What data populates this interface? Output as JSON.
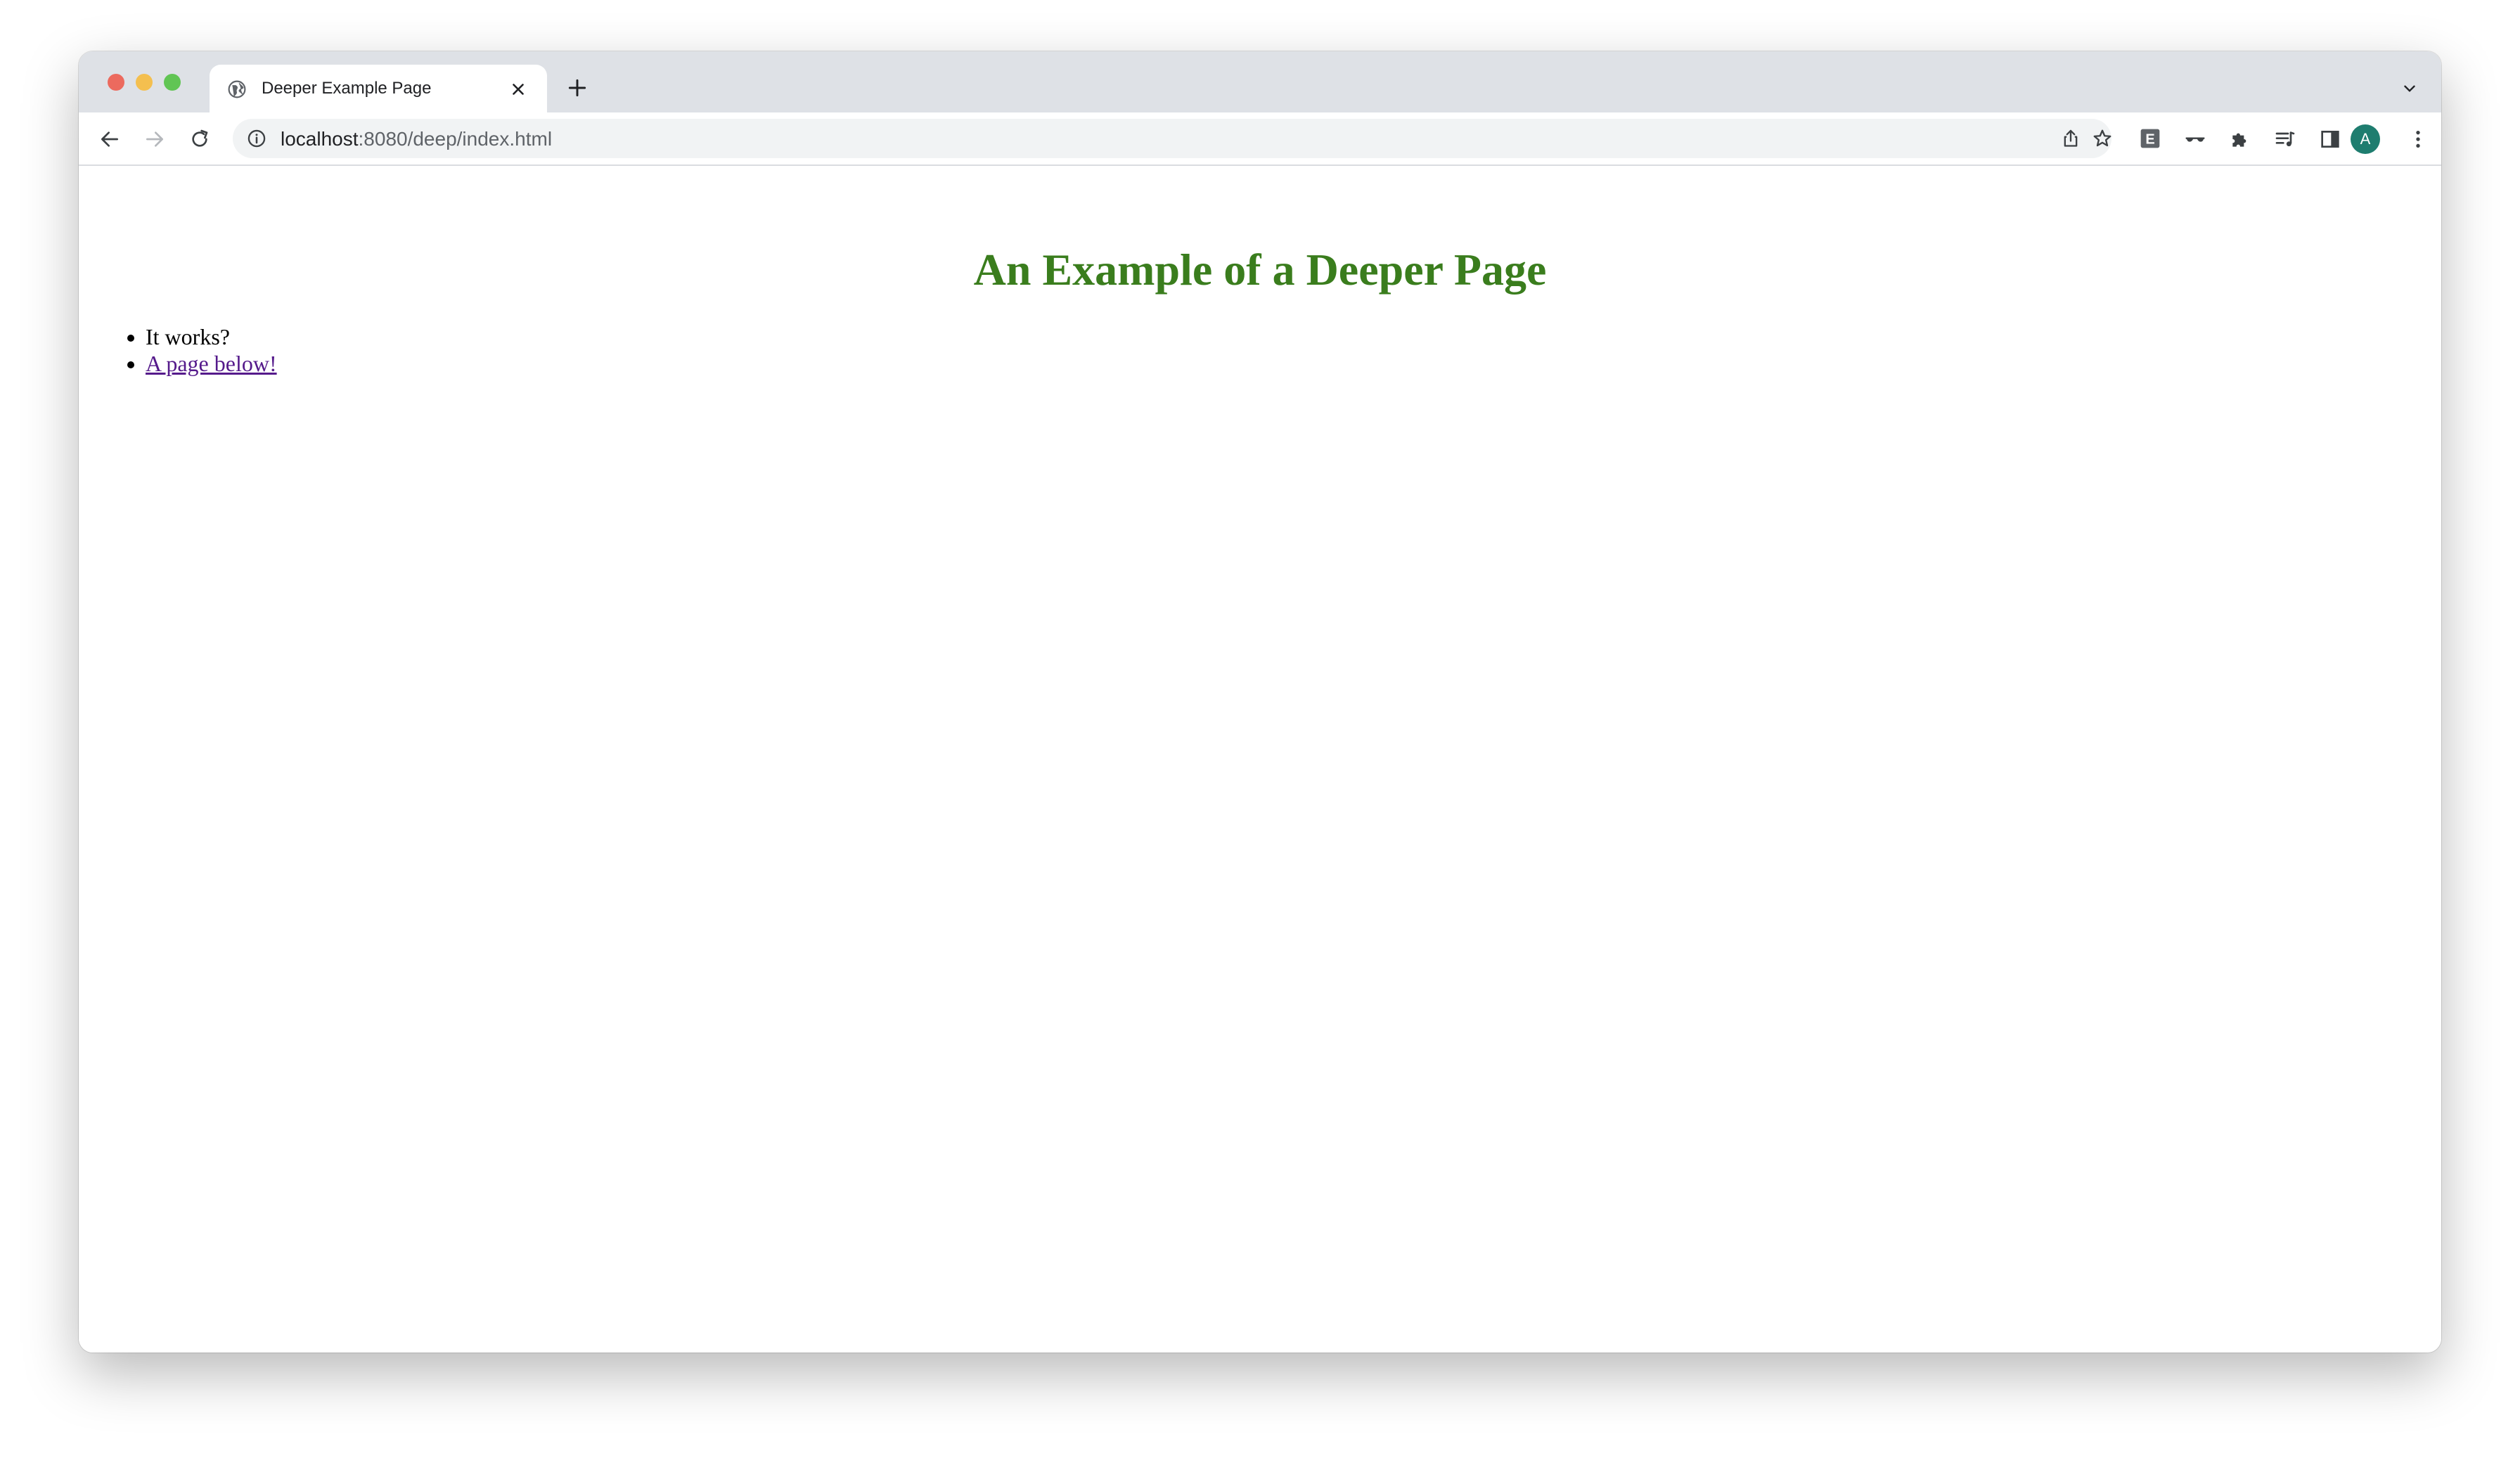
{
  "browser": {
    "tab": {
      "title": "Deeper Example Page"
    },
    "address": {
      "host": "localhost",
      "rest": ":8080/deep/index.html"
    },
    "profile_initial": "A",
    "extension_letter": "E"
  },
  "page": {
    "heading": "An Example of a Deeper Page",
    "heading_color": "#3a7d1d",
    "list": [
      {
        "text": "It works?",
        "is_link": false
      },
      {
        "text": "A page below!",
        "is_link": true
      }
    ],
    "link_color": "#551a8b"
  },
  "icons": [
    "globe-icon",
    "close-icon",
    "plus-icon",
    "chevron-down-icon",
    "back-arrow-icon",
    "forward-arrow-icon",
    "reload-icon",
    "info-icon",
    "share-icon",
    "star-icon",
    "extension-e-icon",
    "glasses-icon",
    "puzzle-icon",
    "reading-list-icon",
    "side-panel-icon",
    "avatar",
    "more-vert-icon"
  ]
}
